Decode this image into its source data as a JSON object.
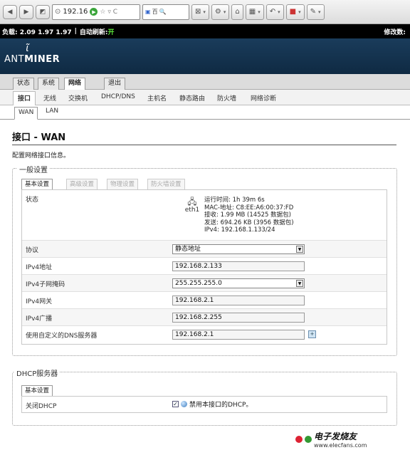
{
  "browser": {
    "url_text": "192.16",
    "search_text": "百",
    "icons": [
      "back-arrow",
      "forward-arrow",
      "favicon",
      "reload",
      "search-engine",
      "screenshot",
      "addon",
      "home",
      "image",
      "undo",
      "apps",
      "tools"
    ]
  },
  "status_bar": {
    "load": "负载: 2.09 1.97 1.97",
    "auto_refresh_label": "自动刷新:",
    "auto_refresh_value": "开",
    "changes": "修改数:"
  },
  "brand": {
    "logo_mark": "ɩ̃",
    "name_prefix": "ANT",
    "name_suffix": "MINER"
  },
  "top_tabs": [
    "状态",
    "系统",
    "网络",
    "退出"
  ],
  "sub_tabs": [
    "接口",
    "无线",
    "交换机",
    "DHCP/DNS",
    "主机名",
    "静态路由",
    "防火墙",
    "网络诊断"
  ],
  "iface_tabs": [
    "WAN",
    "LAN"
  ],
  "page": {
    "title": "接口 - WAN",
    "description": "配置网络接口信息。"
  },
  "general": {
    "legend": "一般设置",
    "tabs": [
      "基本设置",
      "高级设置",
      "物理设置",
      "防火墙设置"
    ],
    "status_label": "状态",
    "iface_name": "eth1",
    "status_lines": [
      "运行时间: 1h 39m 6s",
      "MAC-地址: C8:EE:A6:00:37:FD",
      "接收: 1.99 MB (14525 数据包)",
      "发送: 694.26 KB (3956 数据包)",
      "IPv4: 192.168.1.133/24"
    ],
    "protocol_label": "协议",
    "protocol_value": "静态地址",
    "ipv4_addr_label": "IPv4地址",
    "ipv4_addr_value": "192.168.2.133",
    "netmask_label": "IPv4子网掩码",
    "netmask_value": "255.255.255.0",
    "gateway_label": "IPv4网关",
    "gateway_value": "192.168.2.1",
    "broadcast_label": "IPv4广播",
    "broadcast_value": "192.168.2.255",
    "dns_label": "使用自定义的DNS服务器",
    "dns_value": "192.168.2.1"
  },
  "dhcp": {
    "legend": "DHCP服务器",
    "tab": "基本设置",
    "disable_label": "关闭DHCP",
    "disable_text": "禁用本接口的DHCP。",
    "checked": true
  },
  "watermark": {
    "text": "电子发烧友",
    "site": "www.elecfans.com"
  }
}
